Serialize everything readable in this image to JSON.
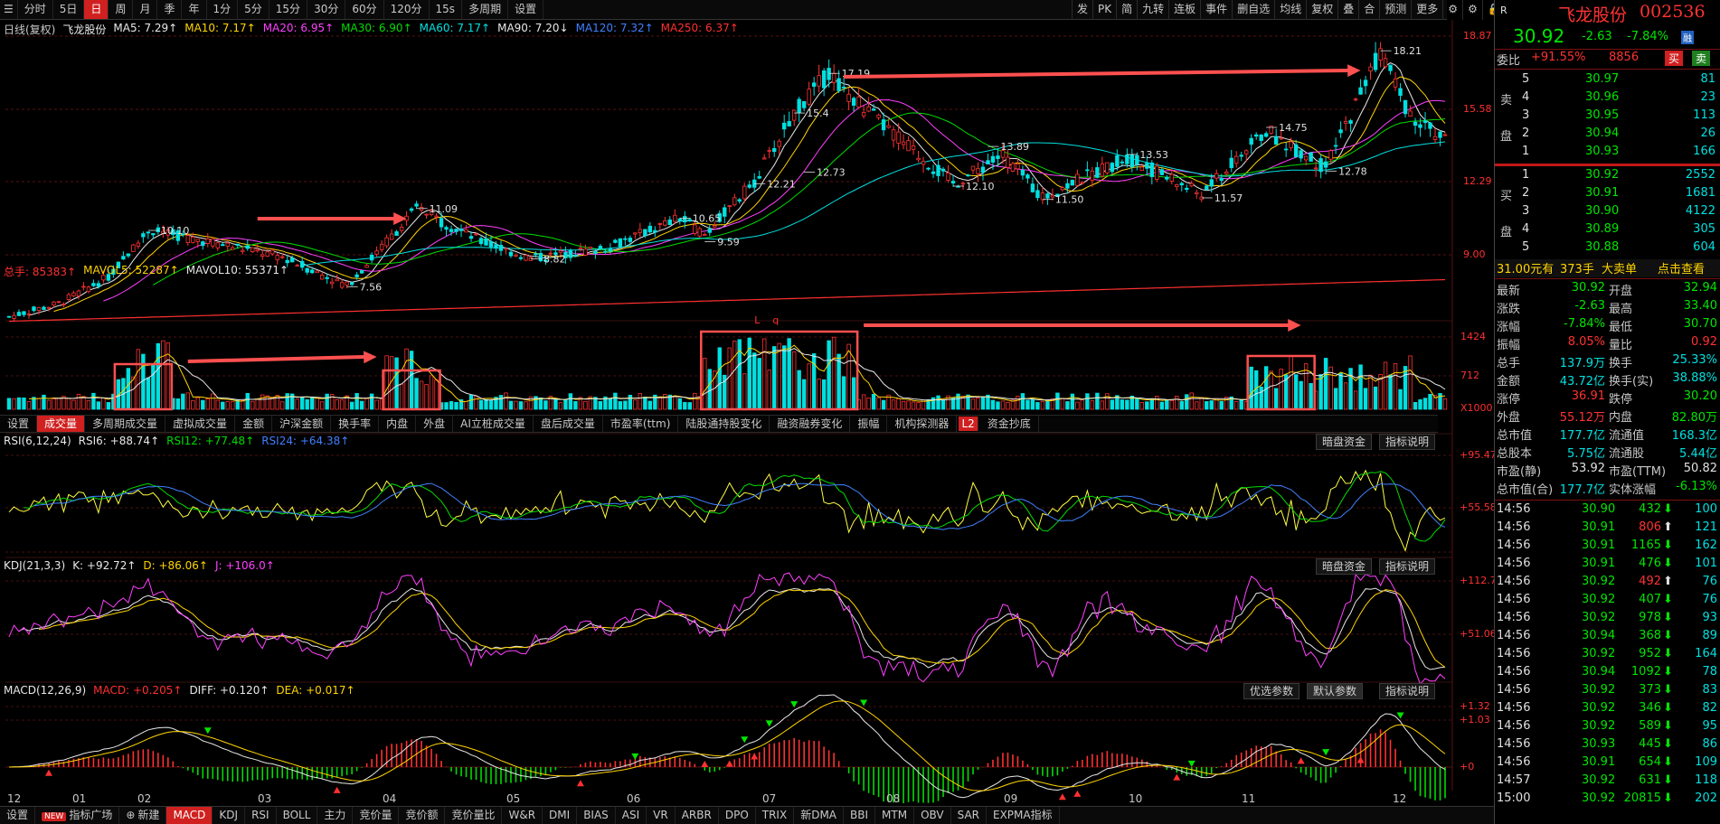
{
  "toolbar": {
    "items": [
      "分时",
      "5日",
      "日",
      "周",
      "月",
      "季",
      "年",
      "1分",
      "5分",
      "15分",
      "30分",
      "60分",
      "120分",
      "15s",
      "多周期",
      "设置"
    ],
    "active": "日",
    "right_items": [
      "发",
      "PK",
      "简",
      "九转",
      "连板",
      "事件",
      "删自选",
      "均线",
      "复权",
      "叠",
      "合",
      "预测",
      "更多"
    ]
  },
  "main_legend": {
    "title": "日线(复权)",
    "stock_name": "飞龙股份",
    "items": [
      {
        "text": "MA5: 7.29↑",
        "color": "#e8e8e8"
      },
      {
        "text": "MA10: 7.17↑",
        "color": "#ffd400"
      },
      {
        "text": "MA20: 6.95↑",
        "color": "#ff40ff"
      },
      {
        "text": "MA30: 6.90↑",
        "color": "#00dc00"
      },
      {
        "text": "MA60: 7.17↑",
        "color": "#00e0e0"
      },
      {
        "text": "MA90: 7.20↓",
        "color": "#e8e8e8"
      },
      {
        "text": "MA120: 7.32↑",
        "color": "#4080ff"
      },
      {
        "text": "MA250: 6.37↑",
        "color": "#ff3030"
      }
    ]
  },
  "price_axis": [
    "18.87",
    "15.58",
    "12.29",
    "9.00"
  ],
  "price_annotations": [
    {
      "text": "10.10",
      "day": 28,
      "price": 10.1
    },
    {
      "text": "11.09",
      "day": 82,
      "price": 11.09
    },
    {
      "text": "8.82",
      "day": 105,
      "price": 8.82
    },
    {
      "text": "10.65",
      "day": 135,
      "price": 10.65
    },
    {
      "text": "9.59",
      "day": 140,
      "price": 9.59
    },
    {
      "text": "15.4",
      "day": 158,
      "price": 15.4
    },
    {
      "text": "12.21",
      "day": 150,
      "price": 12.21
    },
    {
      "text": "12.73",
      "day": 160,
      "price": 12.73
    },
    {
      "text": "17.19",
      "day": 165,
      "price": 17.19
    },
    {
      "text": "13.89",
      "day": 197,
      "price": 13.89
    },
    {
      "text": "12.10",
      "day": 190,
      "price": 12.1
    },
    {
      "text": "11.50",
      "day": 208,
      "price": 11.5
    },
    {
      "text": "13.53",
      "day": 225,
      "price": 13.53
    },
    {
      "text": "11.57",
      "day": 240,
      "price": 11.57
    },
    {
      "text": "14.75",
      "day": 253,
      "price": 14.75
    },
    {
      "text": "12.78",
      "day": 265,
      "price": 12.78
    },
    {
      "text": "18.21",
      "day": 276,
      "price": 18.21
    },
    {
      "text": "7.56",
      "day": 68,
      "price": 7.56
    }
  ],
  "volume_legend": {
    "items": [
      {
        "text": "总手: 85383↑",
        "color": "#ff3030"
      },
      {
        "text": "MAVOL5: 52287↑",
        "color": "#ffd400"
      },
      {
        "text": "MAVOL10: 55371↑",
        "color": "#e8e8e8"
      }
    ]
  },
  "volume_axis": [
    "1424",
    "712",
    "X1000"
  ],
  "volume_marks": [
    "L",
    "q"
  ],
  "indicator_tabs": [
    "设置",
    "成交量",
    "多周期成交量",
    "虚拟成交量",
    "金额",
    "沪深金额",
    "换手率",
    "内盘",
    "外盘",
    "AI立桩成交量",
    "盘后成交量",
    "市盈率(ttm)",
    "陆股通持股变化",
    "融资融券变化",
    "振幅",
    "机构探测器",
    "L2",
    "资金抄底"
  ],
  "indicator_tabs_active": "成交量",
  "rsi": {
    "label": "RSI(6,12,24)",
    "items": [
      {
        "text": "RSI6: +88.74↑",
        "color": "#e8e8e8"
      },
      {
        "text": "RSI12: +77.48↑",
        "color": "#00dc00"
      },
      {
        "text": "RSI24: +64.38↑",
        "color": "#4080ff"
      }
    ],
    "axis": [
      "+95.47",
      "+55.58"
    ],
    "buttons": [
      "暗盘资金",
      "指标说明"
    ]
  },
  "kdj": {
    "label": "KDJ(21,3,3)",
    "items": [
      {
        "text": "K: +92.72↑",
        "color": "#e8e8e8"
      },
      {
        "text": "D: +86.06↑",
        "color": "#ffd400"
      },
      {
        "text": "J: +106.0↑",
        "color": "#ff40ff"
      }
    ],
    "axis": [
      "+112.7",
      "+51.06"
    ],
    "buttons": [
      "暗盘资金",
      "指标说明"
    ]
  },
  "macd": {
    "label": "MACD(12,26,9)",
    "items": [
      {
        "text": "MACD: +0.205↑",
        "color": "#ff3030"
      },
      {
        "text": "DIFF: +0.120↑",
        "color": "#e8e8e8"
      },
      {
        "text": "DEA: +0.017↑",
        "color": "#ffd400"
      }
    ],
    "axis": [
      "+1.32",
      "+1.03",
      "+0"
    ],
    "buttons": [
      "优选参数",
      "默认参数",
      "指标说明"
    ],
    "selected_button": "默认参数"
  },
  "x_axis": [
    "12",
    "01",
    "02",
    "03",
    "04",
    "05",
    "06",
    "07",
    "08",
    "09",
    "10",
    "11",
    "12"
  ],
  "bottom_bar": {
    "items": [
      "设置",
      "指标广场",
      "新建",
      "MACD",
      "KDJ",
      "RSI",
      "BOLL",
      "主力",
      "竞价量",
      "竞价额",
      "竞价量比",
      "W&R",
      "DMI",
      "BIAS",
      "ASI",
      "VR",
      "ARBR",
      "DPO",
      "TRIX",
      "新DMA",
      "BBI",
      "MTM",
      "OBV",
      "SAR",
      "EXPMA指标"
    ],
    "badge": "NEW",
    "active": "MACD"
  },
  "quote": {
    "name": "飞龙股份",
    "code": "002536",
    "price": "30.92",
    "change": "-2.63",
    "change_pct": "-7.84%",
    "tag": "融",
    "weibi_label": "委比",
    "weibi": "+91.55%",
    "weicha": "8856",
    "buy_btn": "买",
    "sell_btn": "卖",
    "sell_label": "卖盘",
    "buy_label": "买盘",
    "asks": [
      {
        "lvl": "5",
        "price": "30.97",
        "vol": "81"
      },
      {
        "lvl": "4",
        "price": "30.96",
        "vol": "23"
      },
      {
        "lvl": "3",
        "price": "30.95",
        "vol": "113"
      },
      {
        "lvl": "2",
        "price": "30.94",
        "vol": "26"
      },
      {
        "lvl": "1",
        "price": "30.93",
        "vol": "166"
      }
    ],
    "bids": [
      {
        "lvl": "1",
        "price": "30.92",
        "vol": "2552"
      },
      {
        "lvl": "2",
        "price": "30.91",
        "vol": "1681"
      },
      {
        "lvl": "3",
        "price": "30.90",
        "vol": "4122"
      },
      {
        "lvl": "4",
        "price": "30.89",
        "vol": "305"
      },
      {
        "lvl": "5",
        "price": "30.88",
        "vol": "604"
      }
    ],
    "big_order": {
      "price": "31.00元有",
      "vol": "373手",
      "label": "大卖单",
      "link": "点击查看"
    },
    "stats": [
      {
        "l1": "最新",
        "v1": "30.92",
        "c1": "dn",
        "l2": "开盘",
        "v2": "32.94",
        "c2": "dn"
      },
      {
        "l1": "涨跌",
        "v1": "-2.63",
        "c1": "dn",
        "l2": "最高",
        "v2": "33.40",
        "c2": "dn"
      },
      {
        "l1": "涨幅",
        "v1": "-7.84%",
        "c1": "dn",
        "l2": "最低",
        "v2": "30.70",
        "c2": "dn"
      },
      {
        "l1": "振幅",
        "v1": "8.05%",
        "c1": "up",
        "l2": "量比",
        "v2": "0.92",
        "c2": "up"
      },
      {
        "l1": "总手",
        "v1": "137.9万",
        "c1": "cy",
        "l2": "换手",
        "v2": "25.33%",
        "c2": "cy"
      },
      {
        "l1": "金额",
        "v1": "43.72亿",
        "c1": "cy",
        "l2": "换手(实)",
        "v2": "38.88%",
        "c2": "cy"
      },
      {
        "l1": "涨停",
        "v1": "36.91",
        "c1": "up",
        "l2": "跌停",
        "v2": "30.20",
        "c2": "dn"
      },
      {
        "l1": "外盘",
        "v1": "55.12万",
        "c1": "up",
        "l2": "内盘",
        "v2": "82.80万",
        "c2": "dn"
      },
      {
        "l1": "总市值",
        "v1": "177.7亿",
        "c1": "cy",
        "l2": "流通值",
        "v2": "168.3亿",
        "c2": "cy"
      },
      {
        "l1": "总股本",
        "v1": "5.75亿",
        "c1": "cy",
        "l2": "流通股",
        "v2": "5.44亿",
        "c2": "cy"
      },
      {
        "l1": "市盈(静)",
        "v1": "53.92",
        "c1": "wh",
        "l2": "市盈(TTM)",
        "v2": "50.82",
        "c2": "wh"
      },
      {
        "l1": "总市值(合)",
        "v1": "177.7亿",
        "c1": "cy",
        "l2": "实体涨幅",
        "v2": "-6.13%",
        "c2": "dn"
      }
    ],
    "ticks": [
      {
        "t": "14:56",
        "p": "30.90",
        "v": "432",
        "d": "dn",
        "n": "100"
      },
      {
        "t": "14:56",
        "p": "30.91",
        "v": "806",
        "d": "up",
        "n": "121"
      },
      {
        "t": "14:56",
        "p": "30.91",
        "v": "1165",
        "d": "dn",
        "n": "162"
      },
      {
        "t": "14:56",
        "p": "30.91",
        "v": "476",
        "d": "dn",
        "n": "101"
      },
      {
        "t": "14:56",
        "p": "30.92",
        "v": "492",
        "d": "up",
        "n": "76"
      },
      {
        "t": "14:56",
        "p": "30.92",
        "v": "407",
        "d": "dn",
        "n": "76"
      },
      {
        "t": "14:56",
        "p": "30.92",
        "v": "978",
        "d": "dn",
        "n": "93"
      },
      {
        "t": "14:56",
        "p": "30.94",
        "v": "368",
        "d": "dn",
        "n": "89"
      },
      {
        "t": "14:56",
        "p": "30.92",
        "v": "952",
        "d": "dn",
        "n": "164"
      },
      {
        "t": "14:56",
        "p": "30.94",
        "v": "1092",
        "d": "dn",
        "n": "78"
      },
      {
        "t": "14:56",
        "p": "30.92",
        "v": "373",
        "d": "dn",
        "n": "83"
      },
      {
        "t": "14:56",
        "p": "30.92",
        "v": "346",
        "d": "dn",
        "n": "82"
      },
      {
        "t": "14:56",
        "p": "30.92",
        "v": "589",
        "d": "dn",
        "n": "95"
      },
      {
        "t": "14:56",
        "p": "30.93",
        "v": "445",
        "d": "dn",
        "n": "86"
      },
      {
        "t": "14:56",
        "p": "30.91",
        "v": "654",
        "d": "dn",
        "n": "109"
      },
      {
        "t": "14:57",
        "p": "30.92",
        "v": "631",
        "d": "dn",
        "n": "118"
      },
      {
        "t": "15:00",
        "p": "30.92",
        "v": "20815",
        "d": "dn",
        "n": "202"
      }
    ]
  },
  "colors": {
    "up": "#ff3232",
    "down": "#00e0e0",
    "ma5": "#e8e8e8",
    "ma10": "#ffd400",
    "ma20": "#ff40ff",
    "ma30": "#00dc00",
    "ma60": "#00e0e0",
    "ma250": "#ff3030"
  }
}
